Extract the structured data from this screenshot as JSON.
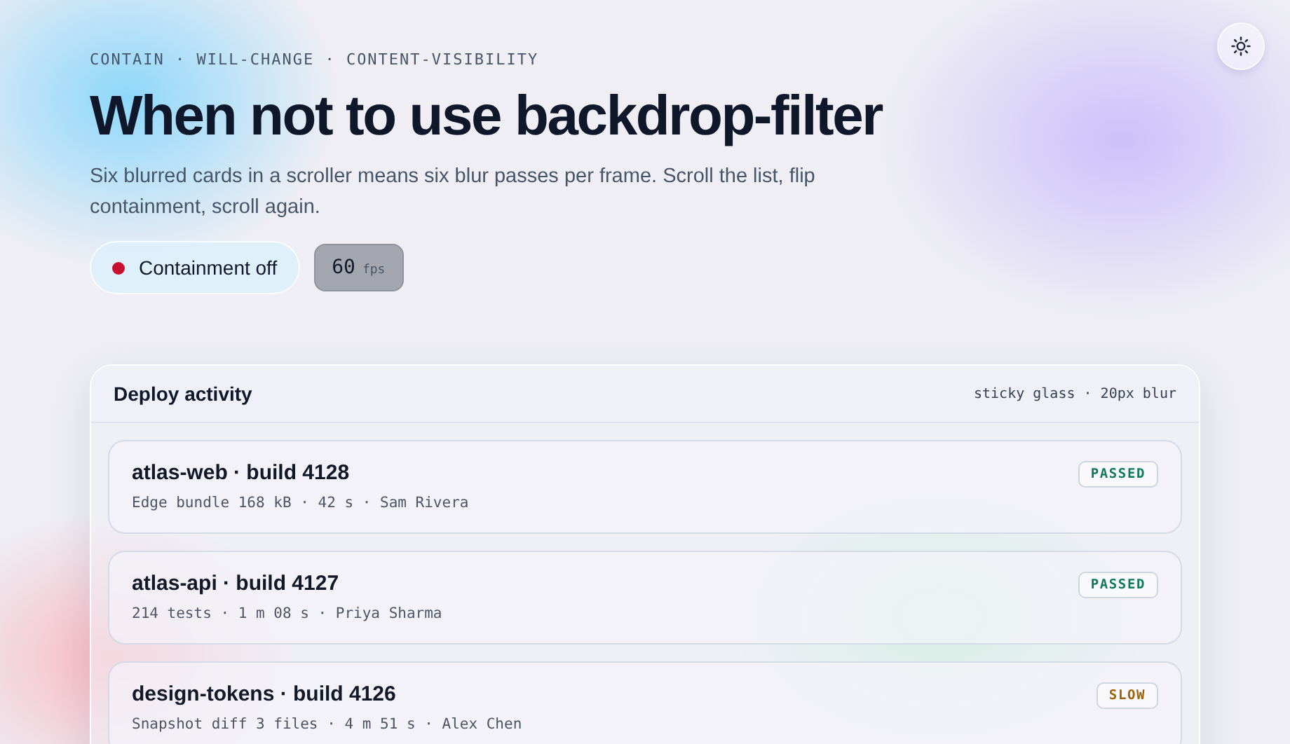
{
  "eyebrow": "CONTAIN · WILL-CHANGE · CONTENT-VISIBILITY",
  "title": "When not to use backdrop-filter",
  "subtitle": "Six blurred cards in a scroller means six blur passes per frame. Scroll the list, flip containment, scroll again.",
  "containment": {
    "label": "Containment off",
    "on": false
  },
  "fps": {
    "value": "60",
    "unit": "fps"
  },
  "panel": {
    "title": "Deploy activity",
    "note": "sticky glass · 20px blur",
    "builds": [
      {
        "title": "atlas-web · build 4128",
        "meta": "Edge bundle 168 kB · 42 s · Sam Rivera",
        "status": "PASSED",
        "kind": "passed"
      },
      {
        "title": "atlas-api · build 4127",
        "meta": "214 tests · 1 m 08 s · Priya Sharma",
        "status": "PASSED",
        "kind": "passed"
      },
      {
        "title": "design-tokens · build 4126",
        "meta": "Snapshot diff 3 files · 4 m 51 s · Alex Chen",
        "status": "SLOW",
        "kind": "slow"
      }
    ]
  }
}
